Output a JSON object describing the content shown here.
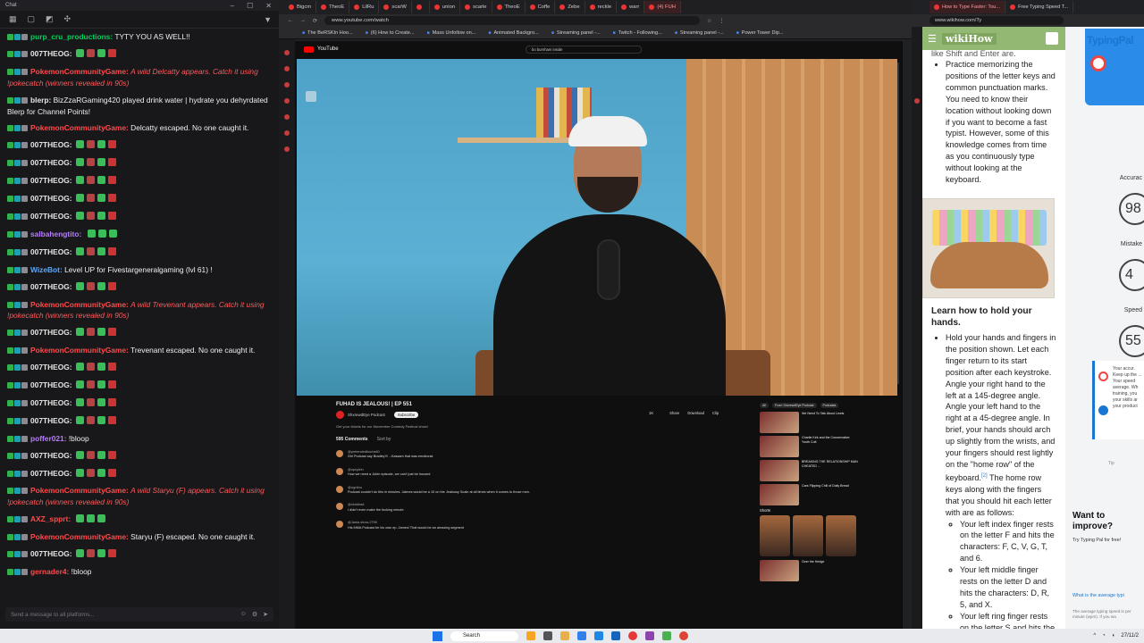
{
  "chat": {
    "title": "Chat",
    "input_placeholder": "Send a message to all platforms...",
    "messages": [
      {
        "type": "text",
        "user": "purp_cru_productions:",
        "text": "TYTY YOU AS WELL!!",
        "ucolor": "u-green"
      },
      {
        "type": "emote",
        "user": "007THEOG:"
      },
      {
        "type": "alert",
        "user": "PokemonCommunityGame:",
        "text": "A wild Delcatty appears. Catch it using !pokecatch (winners revealed in 90s)"
      },
      {
        "type": "text",
        "user": "blerp:",
        "text": "BizZzaRGaming420 played drink water | hydrate you dehyrdated Blerp for Channel Points!",
        "ucolor": "u-white"
      },
      {
        "type": "text",
        "user": "PokemonCommunityGame:",
        "text": "Delcatty escaped. No one caught it.",
        "ucolor": "u-red"
      },
      {
        "type": "emote",
        "user": "007THEOG:"
      },
      {
        "type": "emote",
        "user": "007THEOG:"
      },
      {
        "type": "emote",
        "user": "007THEOG:"
      },
      {
        "type": "emote",
        "user": "007THEOG:"
      },
      {
        "type": "emote",
        "user": "007THEOG:"
      },
      {
        "type": "text",
        "user": "salbahengtito:",
        "text": "",
        "ucolor": "u-purple"
      },
      {
        "type": "emote",
        "user": "007THEOG:"
      },
      {
        "type": "text",
        "user": "WizeBot:",
        "text": "Level UP for Fivestargeneralgaming (lvl 61) !",
        "ucolor": "u-blue"
      },
      {
        "type": "emote",
        "user": "007THEOG:"
      },
      {
        "type": "alert",
        "user": "PokemonCommunityGame:",
        "text": "A wild Trevenant appears. Catch it using !pokecatch (winners revealed in 90s)"
      },
      {
        "type": "emote",
        "user": "007THEOG:"
      },
      {
        "type": "text",
        "user": "PokemonCommunityGame:",
        "text": "Trevenant escaped. No one caught it.",
        "ucolor": "u-red"
      },
      {
        "type": "emote",
        "user": "007THEOG:"
      },
      {
        "type": "emote",
        "user": "007THEOG:"
      },
      {
        "type": "emote",
        "user": "007THEOG:"
      },
      {
        "type": "emote",
        "user": "007THEOG:"
      },
      {
        "type": "text",
        "user": "poffer021:",
        "text": "!bloop",
        "ucolor": "u-purple"
      },
      {
        "type": "emote",
        "user": "007THEOG:"
      },
      {
        "type": "emote",
        "user": "007THEOG:"
      },
      {
        "type": "alert",
        "user": "PokemonCommunityGame:",
        "text": "A wild Staryu (F) appears. Catch it using !pokecatch (winners revealed in 90s)"
      },
      {
        "type": "text",
        "user": "AXZ_spprt:",
        "text": "",
        "ucolor": "u-red"
      },
      {
        "type": "text",
        "user": "PokemonCommunityGame:",
        "text": "Staryu (F) escaped. No one caught it.",
        "ucolor": "u-red"
      },
      {
        "type": "emote",
        "user": "007THEOG:"
      },
      {
        "type": "text",
        "user": "gernader4:",
        "text": "!bloop",
        "ucolor": "u-red"
      }
    ]
  },
  "browser": {
    "tabs": [
      "Bigcm",
      "TheoE",
      "LilRu",
      "scarW",
      "",
      "union",
      "scarle",
      "TheoE",
      "Coffe",
      "Zebe",
      "reckle",
      "warr",
      "(4) FUH"
    ],
    "url": "www.youtube.com/watch",
    "bookmarks": [
      "The BeRSKIn Hoo...",
      "(6) How to Create...",
      "Mass Unfollow on...",
      "Animated Backgro...",
      "Streaming panel -...",
      "Twitch - Following...",
      "Streaming panel -...",
      "Power Tower Dip..."
    ],
    "search_text": "bo burnham inside"
  },
  "youtube": {
    "video_title": "FUHAD IS JEALOUS! | EP 551",
    "channel": "ShxrewdEye Podcast",
    "subscribe": "Subscribe",
    "actions": [
      "1K",
      "",
      "Share",
      "Download",
      "Clip"
    ],
    "desc": "Get your tickets for our Movember Comedy Festival show!",
    "comments_count": "595 Comments",
    "sort_label": "Sort by",
    "comments": [
      {
        "user": "@pretendedfourbs60",
        "text": "Girl Podcast say Bradley!!! ...Kassam that was emotional"
      },
      {
        "user": "@oprydrin",
        "text": "How we need a Jubin episode, we can't just be housed"
      },
      {
        "user": "@ogvlino",
        "text": "Podcast couldn't do this in minutes. Jaimes would be a 10 on the Jealousy Scale at all times when it comes to those men."
      },
      {
        "user": "@shobbad",
        "text": "I didn't even make the fucking minute"
      },
      {
        "user": "@Jama.show-2795",
        "text": "His MMA Podcast be his own ep. James! That would be an amazing segment"
      }
    ],
    "side_chips": [
      "All",
      "From ShxrewdEye Podcast",
      "Podcasts"
    ],
    "recs": [
      {
        "title": "We Need To Talk About Lewis"
      },
      {
        "title": "Charlie Kirk and the Conservative Youth Cult"
      },
      {
        "title": "BREAKING THE RELATIONSHIP MAN CHEATED ..."
      },
      {
        "title": "Cars Flipping Chill of Daily Bread"
      }
    ],
    "shorts_label": "Shorts",
    "last_rec": "Over the Hedge"
  },
  "wiki": {
    "logo": "wikiHow",
    "cut_text": "like Shift and Enter are.",
    "p1": "Practice memorizing the positions of the letter keys and common punctuation marks. You need to know their location without looking down if you want to become a fast typist. However, some of this knowledge comes from time as you continuously type without looking at the keyboard.",
    "h3": "Learn how to hold your hands.",
    "p2": "Hold your hands and fingers in the position shown. Let each finger return to its start position after each keystroke. Angle your right hand to the left at a 145-degree angle. Angle your left hand to the right at a 45-degree angle. In brief, your hands should arch up slightly from the wrists, and your fingers should rest lightly on the \"home row\" of the keyboard.",
    "sup": "[2]",
    "p3": "The home row keys along with the fingers that you should hit each letter with are as follows:",
    "li1": "Your left index finger rests on the letter F and hits the characters: F, C, V, G, T, and 6.",
    "li2": "Your left middle finger rests on the letter D and hits the characters: D, R, 5, and X.",
    "li3": "Your left ring finger rests on the letter S and hits the"
  },
  "right_tabs": [
    "How to Type Faster: Tou...",
    "Free Typing Speed T..."
  ],
  "right_url": "www.wikihow.com/Ty",
  "typing": {
    "logo": "TypingPal",
    "accuracy_label": "Accurac",
    "accuracy": "98",
    "mistakes_label": "Mistake",
    "mistakes": "4",
    "speed_label": "Speed",
    "speed": "55",
    "note": "Your accur. Keep up the ... Your speed average. Wh training, you your skills ar your product",
    "tip": "Tip",
    "want": "Want to improve?",
    "try": "Try Typing Pal for free!",
    "avg_q": "What is the average typi",
    "avg_a": "The average typing speed is per minute (wpm). If you wa"
  },
  "taskbar": {
    "search": "Search",
    "time": "",
    "date": "27/11/2"
  }
}
